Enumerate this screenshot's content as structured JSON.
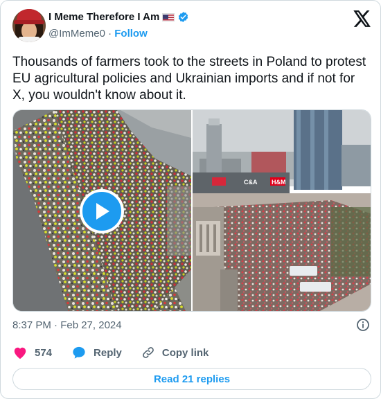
{
  "author": {
    "display_name": "I Meme Therefore I Am",
    "handle": "@ImMeme0",
    "follow_label": "Follow",
    "separator": "·",
    "verified_color": "#1d9bf0"
  },
  "tweet": {
    "text": "Thousands of farmers took to the streets in Poland to protest EU agricultural policies and Ukrainian imports and if not for X, you wouldn't know about it."
  },
  "media": {
    "items": [
      {
        "type": "video",
        "icon": "play-icon"
      },
      {
        "type": "image"
      }
    ],
    "signs": {
      "store_one": "C&A",
      "store_two": "H&M"
    }
  },
  "meta": {
    "timestamp": "8:37 PM · Feb 27, 2024"
  },
  "actions": {
    "likes": "574",
    "reply_label": "Reply",
    "copy_link_label": "Copy link"
  },
  "footer": {
    "read_replies_label": "Read 21 replies"
  },
  "colors": {
    "accent": "#1d9bf0",
    "like": "#f91880",
    "text": "#0f1419",
    "muted": "#536471",
    "border": "#cfd9de"
  }
}
